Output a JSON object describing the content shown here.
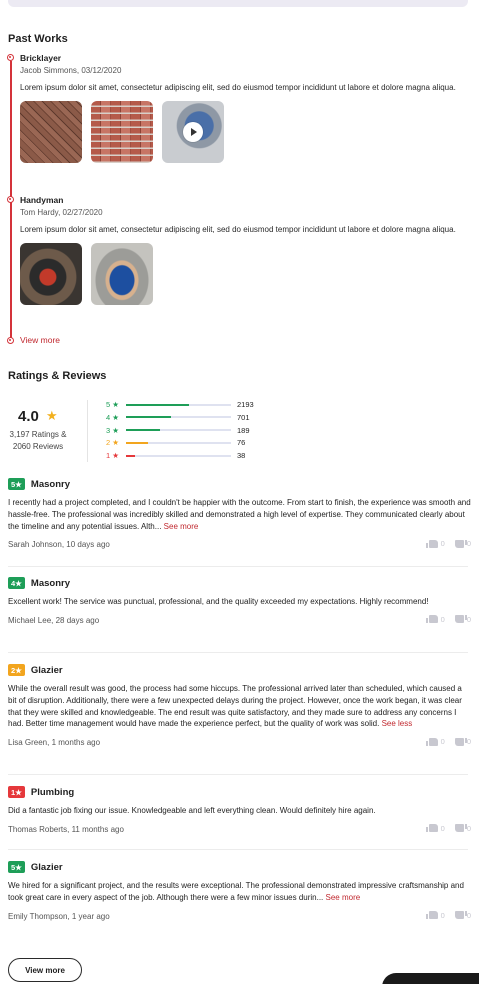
{
  "past_works": {
    "title": "Past Works",
    "items": [
      {
        "title": "Bricklayer",
        "meta": "Jacob Simmons, 03/12/2020",
        "description": "Lorem ipsum dolor sit amet, consectetur adipiscing elit, sed do eiusmod tempor incididunt ut labore et dolore magna aliqua.",
        "media": [
          "herringbone-brick-photo",
          "red-brick-wall-photo",
          "worker-video"
        ]
      },
      {
        "title": "Handyman",
        "meta": "Tom Hardy, 02/27/2020",
        "description": "Lorem ipsum dolor sit amet, consectetur adipiscing elit, sed do eiusmod tempor incididunt ut labore et dolore magna aliqua.",
        "media": [
          "miter-saw-photo",
          "worker-photo"
        ]
      }
    ],
    "view_more": "View more"
  },
  "ratings": {
    "title": "Ratings & Reviews",
    "average": "4.0",
    "counts_line1": "3,197 Ratings &",
    "counts_line2": "2060 Reviews",
    "star_color": "#f2b01e",
    "histogram": [
      {
        "label": "5 ★",
        "count": 2193,
        "fraction": 0.6,
        "color": "#1e9e58"
      },
      {
        "label": "4 ★",
        "count": 701,
        "fraction": 0.43,
        "color": "#1e9e58"
      },
      {
        "label": "3 ★",
        "count": 189,
        "fraction": 0.32,
        "color": "#1e9e58"
      },
      {
        "label": "2 ★",
        "count": 76,
        "fraction": 0.21,
        "color": "#f2a51e"
      },
      {
        "label": "1 ★",
        "count": 38,
        "fraction": 0.09,
        "color": "#e5383b"
      }
    ]
  },
  "reviews": [
    {
      "badge": "5★",
      "badge_color": "#1e9e58",
      "category": "Masonry",
      "text": "I recently had a project completed, and I couldn't be happier with the outcome. From start to finish, the experience was smooth and hassle-free. The professional was incredibly skilled and demonstrated a high level of expertise. They communicated clearly about the timeline and any potential issues. Alth...",
      "link": "See more",
      "author": "Sarah Johnson, 10 days ago",
      "up": "0",
      "down": "0"
    },
    {
      "badge": "4★",
      "badge_color": "#1e9e58",
      "category": "Masonry",
      "text": "Excellent work! The service was punctual, professional, and the quality exceeded my expectations. Highly recommend!",
      "link": "",
      "author": "Michael Lee, 28 days ago",
      "up": "0",
      "down": "0"
    },
    {
      "badge": "2★",
      "badge_color": "#f2a51e",
      "category": "Glazier",
      "text": "While the overall result was good, the process had some hiccups. The professional arrived later than scheduled, which caused a bit of disruption. Additionally, there were a few unexpected delays during the project. However, once the work began, it was clear that they were skilled and knowledgeable. The end result was quite satisfactory, and they made sure to address any concerns I had. Better time management would have made the experience perfect, but the quality of work was solid.",
      "link": "See less",
      "author": "Lisa Green, 1 months ago",
      "up": "0",
      "down": "0"
    },
    {
      "badge": "1★",
      "badge_color": "#e5383b",
      "category": "Plumbing",
      "text": "Did a fantastic job fixing our issue. Knowledgeable and left everything clean. Would definitely hire again.",
      "link": "",
      "author": "Thomas Roberts, 11 months ago",
      "up": "0",
      "down": "0"
    },
    {
      "badge": "5★",
      "badge_color": "#1e9e58",
      "category": "Glazier",
      "text": "We hired for a significant project, and the results were exceptional. The professional demonstrated impressive craftsmanship and took great care in every aspect of the job. Although there were a few minor issues durin...",
      "link": "See more",
      "author": "Emily Thompson, 1 year ago",
      "up": "0",
      "down": "0"
    }
  ],
  "view_more_button": "View more"
}
